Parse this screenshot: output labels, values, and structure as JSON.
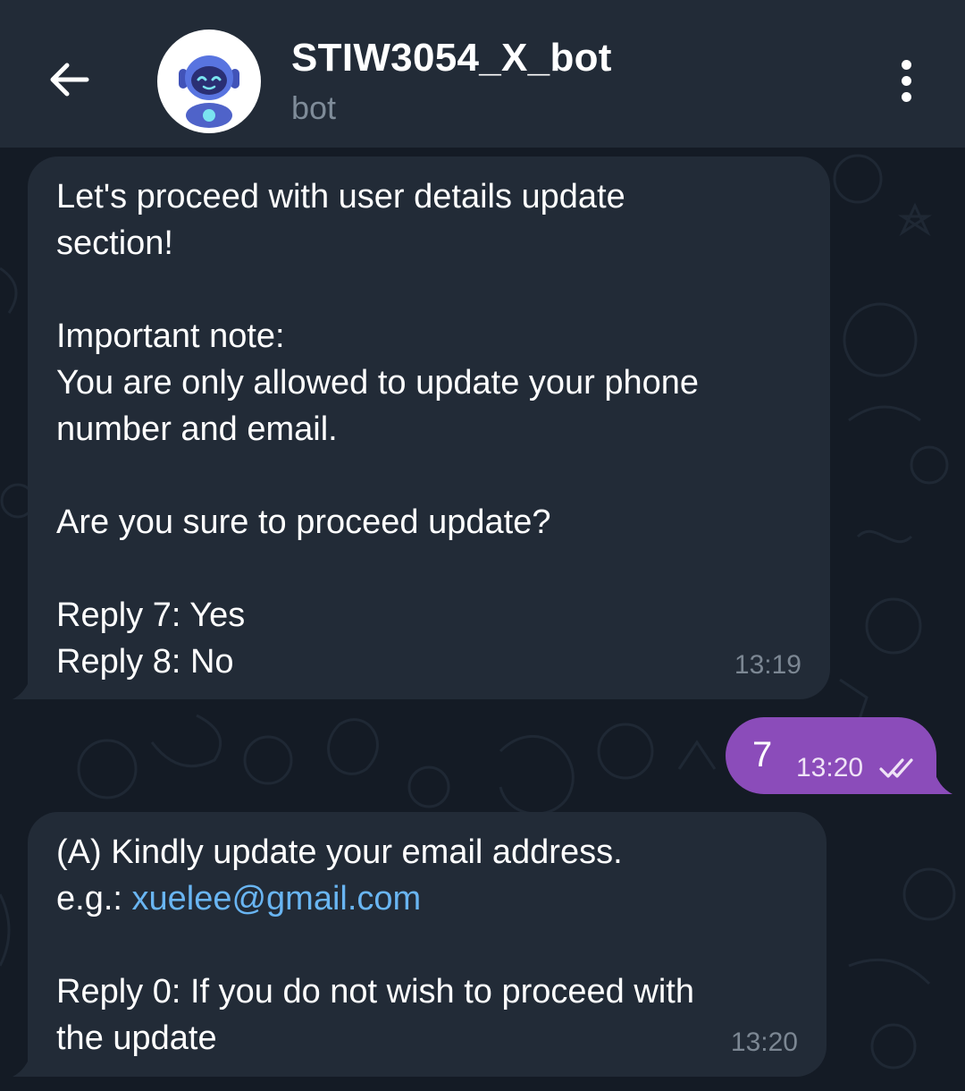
{
  "header": {
    "title": "STIW3054_X_bot",
    "subtitle": "bot"
  },
  "messages": [
    {
      "side": "incoming",
      "text": "Let's proceed with user details update\nsection!\n\nImportant note:\nYou are only allowed to update your phone\nnumber and email.\n\nAre you sure to proceed update?\n\nReply 7: Yes\nReply 8: No",
      "time": "13:19"
    },
    {
      "side": "outgoing",
      "text": "7",
      "time": "13:20",
      "status": "read"
    },
    {
      "side": "incoming",
      "line1": "(A) Kindly update your email address.",
      "line2_prefix": "e.g.: ",
      "line2_link": "xuelee@gmail.com",
      "rest": "Reply 0: If you do not wish to proceed with\nthe update",
      "time": "13:20"
    }
  ],
  "colors": {
    "header_bg": "#222b37",
    "chat_bg": "#141b25",
    "incoming_bubble": "#222b37",
    "outgoing_bubble": "#8b4cba",
    "link": "#69b5f2"
  },
  "icons": [
    "arrow-left-icon",
    "bot-avatar",
    "more-vert-icon",
    "double-check-icon"
  ]
}
